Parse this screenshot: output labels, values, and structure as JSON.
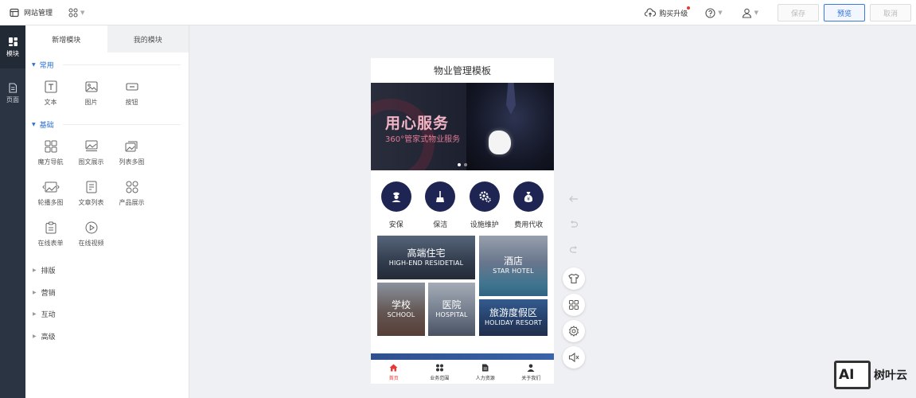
{
  "topbar": {
    "site_label": "网站管理",
    "upgrade_label": "购买升级",
    "save_label": "保存",
    "preview_label": "预览",
    "cancel_label": "取消"
  },
  "rail": {
    "items": [
      {
        "label": "模块",
        "icon": "modules-icon"
      },
      {
        "label": "页面",
        "icon": "page-icon"
      }
    ]
  },
  "panel": {
    "tabs": [
      "新增模块",
      "我的模块"
    ],
    "groups": [
      {
        "title": "常用",
        "items": [
          {
            "label": "文本",
            "icon": "text-icon"
          },
          {
            "label": "图片",
            "icon": "image-icon"
          },
          {
            "label": "按钮",
            "icon": "button-icon"
          }
        ]
      },
      {
        "title": "基础",
        "items": [
          {
            "label": "魔方导航",
            "icon": "cube-nav-icon"
          },
          {
            "label": "图文展示",
            "icon": "image-text-icon"
          },
          {
            "label": "列表多图",
            "icon": "list-images-icon"
          },
          {
            "label": "轮播多图",
            "icon": "carousel-icon"
          },
          {
            "label": "文章列表",
            "icon": "article-list-icon"
          },
          {
            "label": "产品展示",
            "icon": "product-icon"
          },
          {
            "label": "在线表单",
            "icon": "form-icon"
          },
          {
            "label": "在线视频",
            "icon": "video-icon"
          }
        ]
      }
    ],
    "collapsed_groups": [
      "排版",
      "营销",
      "互动",
      "高级"
    ]
  },
  "phone": {
    "title": "物业管理模板",
    "banner_heading": "用心服务",
    "banner_sub": "360°管家式物业服务",
    "services": [
      {
        "label": "安保",
        "icon": "security-guard-icon"
      },
      {
        "label": "保洁",
        "icon": "cleaning-icon"
      },
      {
        "label": "设施维护",
        "icon": "maintenance-icon"
      },
      {
        "label": "费用代收",
        "icon": "fee-bag-icon"
      }
    ],
    "tiles": [
      {
        "zh": "高端住宅",
        "en": "HIGH-END RESIDETIAL"
      },
      {
        "zh": "酒店",
        "en": "STAR HOTEL"
      },
      {
        "zh": "学校",
        "en": "SCHOOL"
      },
      {
        "zh": "医院",
        "en": "HOSPITAL"
      },
      {
        "zh": "旅游度假区",
        "en": "HOLIDAY RESORT"
      }
    ],
    "bottom_nav": [
      {
        "label": "首页",
        "icon": "home-icon"
      },
      {
        "label": "业务范围",
        "icon": "grid-icon"
      },
      {
        "label": "人力资源",
        "icon": "document-icon"
      },
      {
        "label": "关于我们",
        "icon": "person-icon"
      }
    ]
  },
  "watermark": {
    "logo_text": "AI",
    "text": "树叶云"
  },
  "colors": {
    "accent": "#2a6fd6",
    "rail": "#2b3442",
    "service_circle": "#1e2552",
    "nav_active": "#e53935"
  }
}
